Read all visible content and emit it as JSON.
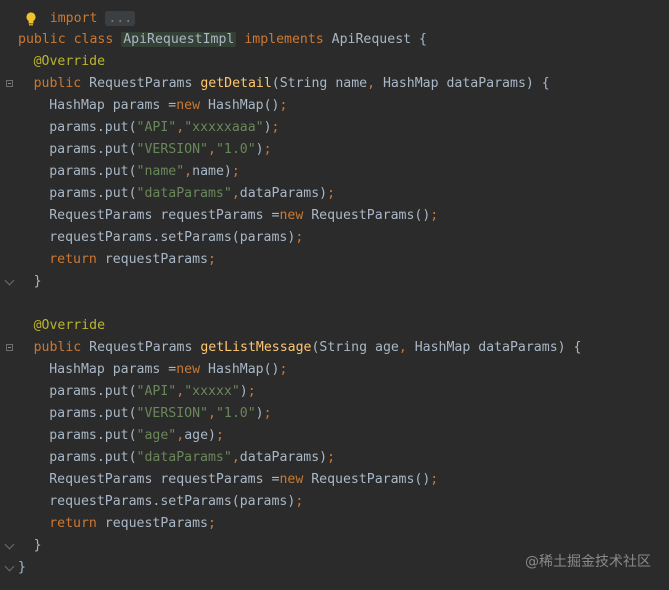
{
  "top_line": {
    "keyword": "import",
    "dots": "..."
  },
  "lines": [
    {
      "indent": 0,
      "tokens": [
        [
          "kw",
          "public "
        ],
        [
          "kw",
          "class "
        ],
        [
          "hlc",
          "ApiRequestImpl"
        ],
        [
          "plain",
          " "
        ],
        [
          "kw",
          "implements "
        ],
        [
          "plain",
          "ApiRequest {"
        ]
      ]
    },
    {
      "indent": 1,
      "tokens": [
        [
          "ann",
          "@Override"
        ]
      ]
    },
    {
      "indent": 1,
      "tokens": [
        [
          "kw",
          "public "
        ],
        [
          "plain",
          "RequestParams "
        ],
        [
          "fn",
          "getDetail"
        ],
        [
          "plain",
          "(String name"
        ],
        [
          "kw",
          ", "
        ],
        [
          "plain",
          "HashMap dataParams) {"
        ]
      ]
    },
    {
      "indent": 2,
      "tokens": [
        [
          "plain",
          "HashMap params ="
        ],
        [
          "kw",
          "new "
        ],
        [
          "plain",
          "HashMap()"
        ],
        [
          "kw",
          ";"
        ]
      ]
    },
    {
      "indent": 2,
      "tokens": [
        [
          "plain",
          "params.put("
        ],
        [
          "str",
          "\"API\""
        ],
        [
          "kw",
          ","
        ],
        [
          "str",
          "\"xxxxxaaa\""
        ],
        [
          "plain",
          ")"
        ],
        [
          "kw",
          ";"
        ]
      ]
    },
    {
      "indent": 2,
      "tokens": [
        [
          "plain",
          "params.put("
        ],
        [
          "str",
          "\"VERSION\""
        ],
        [
          "kw",
          ","
        ],
        [
          "str",
          "\"1.0\""
        ],
        [
          "plain",
          ")"
        ],
        [
          "kw",
          ";"
        ]
      ]
    },
    {
      "indent": 2,
      "tokens": [
        [
          "plain",
          "params.put("
        ],
        [
          "str",
          "\"name\""
        ],
        [
          "kw",
          ","
        ],
        [
          "plain",
          "name)"
        ],
        [
          "kw",
          ";"
        ]
      ]
    },
    {
      "indent": 2,
      "tokens": [
        [
          "plain",
          "params.put("
        ],
        [
          "str",
          "\"dataParams\""
        ],
        [
          "kw",
          ","
        ],
        [
          "plain",
          "dataParams)"
        ],
        [
          "kw",
          ";"
        ]
      ]
    },
    {
      "indent": 2,
      "tokens": [
        [
          "plain",
          "RequestParams requestParams ="
        ],
        [
          "kw",
          "new "
        ],
        [
          "plain",
          "RequestParams()"
        ],
        [
          "kw",
          ";"
        ]
      ]
    },
    {
      "indent": 2,
      "tokens": [
        [
          "plain",
          "requestParams.setParams(params)"
        ],
        [
          "kw",
          ";"
        ]
      ]
    },
    {
      "indent": 2,
      "tokens": [
        [
          "kw",
          "return "
        ],
        [
          "plain",
          "requestParams"
        ],
        [
          "kw",
          ";"
        ]
      ]
    },
    {
      "indent": 1,
      "tokens": [
        [
          "plain",
          "}"
        ]
      ]
    },
    {
      "indent": 0,
      "tokens": []
    },
    {
      "indent": 1,
      "tokens": [
        [
          "ann",
          "@Override"
        ]
      ]
    },
    {
      "indent": 1,
      "tokens": [
        [
          "kw",
          "public "
        ],
        [
          "plain",
          "RequestParams "
        ],
        [
          "fn",
          "getListMessage"
        ],
        [
          "plain",
          "(String age"
        ],
        [
          "kw",
          ", "
        ],
        [
          "plain",
          "HashMap dataParams) {"
        ]
      ]
    },
    {
      "indent": 2,
      "tokens": [
        [
          "plain",
          "HashMap params ="
        ],
        [
          "kw",
          "new "
        ],
        [
          "plain",
          "HashMap()"
        ],
        [
          "kw",
          ";"
        ]
      ]
    },
    {
      "indent": 2,
      "tokens": [
        [
          "plain",
          "params.put("
        ],
        [
          "str",
          "\"API\""
        ],
        [
          "kw",
          ","
        ],
        [
          "str",
          "\"xxxxx\""
        ],
        [
          "plain",
          ")"
        ],
        [
          "kw",
          ";"
        ]
      ]
    },
    {
      "indent": 2,
      "tokens": [
        [
          "plain",
          "params.put("
        ],
        [
          "str",
          "\"VERSION\""
        ],
        [
          "kw",
          ","
        ],
        [
          "str",
          "\"1.0\""
        ],
        [
          "plain",
          ")"
        ],
        [
          "kw",
          ";"
        ]
      ]
    },
    {
      "indent": 2,
      "tokens": [
        [
          "plain",
          "params.put("
        ],
        [
          "str",
          "\"age\""
        ],
        [
          "kw",
          ","
        ],
        [
          "plain",
          "age)"
        ],
        [
          "kw",
          ";"
        ]
      ]
    },
    {
      "indent": 2,
      "tokens": [
        [
          "plain",
          "params.put("
        ],
        [
          "str",
          "\"dataParams\""
        ],
        [
          "kw",
          ","
        ],
        [
          "plain",
          "dataParams)"
        ],
        [
          "kw",
          ";"
        ]
      ]
    },
    {
      "indent": 2,
      "tokens": [
        [
          "plain",
          "RequestParams requestParams ="
        ],
        [
          "kw",
          "new "
        ],
        [
          "plain",
          "RequestParams()"
        ],
        [
          "kw",
          ";"
        ]
      ]
    },
    {
      "indent": 2,
      "tokens": [
        [
          "plain",
          "requestParams.setParams(params)"
        ],
        [
          "kw",
          ";"
        ]
      ]
    },
    {
      "indent": 2,
      "tokens": [
        [
          "kw",
          "return "
        ],
        [
          "plain",
          "requestParams"
        ],
        [
          "kw",
          ";"
        ]
      ]
    },
    {
      "indent": 1,
      "tokens": [
        [
          "plain",
          "}"
        ]
      ]
    },
    {
      "indent": 0,
      "tokens": [
        [
          "plain",
          "}"
        ]
      ]
    }
  ],
  "fold_markers": [
    {
      "line": 2,
      "kind": "open"
    },
    {
      "line": 11,
      "kind": "end"
    },
    {
      "line": 14,
      "kind": "open"
    },
    {
      "line": 23,
      "kind": "end"
    },
    {
      "line": 24,
      "kind": "end"
    }
  ],
  "icons": {
    "intention": "lightbulb-icon",
    "fold_open": "fold-open-icon",
    "fold_end": "fold-end-icon"
  },
  "colors": {
    "background": "#2b2b2b",
    "keyword": "#cc7832",
    "string": "#6a8759",
    "annotation": "#bbb529",
    "method": "#ffc66d",
    "text": "#a9b7c6"
  },
  "watermark": "@稀土掘金技术社区"
}
